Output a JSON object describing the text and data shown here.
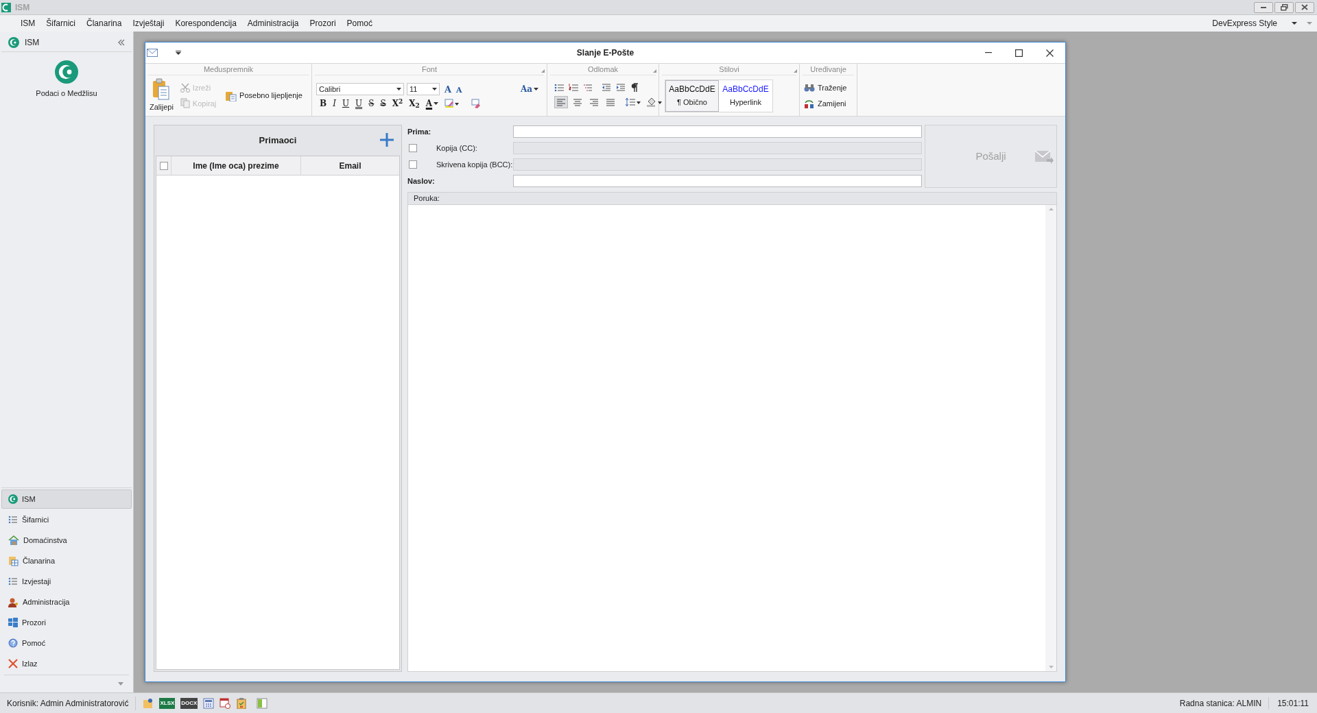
{
  "app": {
    "title": "ISM"
  },
  "menu_bar": {
    "items": [
      "ISM",
      "Šifarnici",
      "Članarina",
      "Izvještaji",
      "Korespondencija",
      "Administracija",
      "Prozori",
      "Pomoć"
    ],
    "theme": "DevExpress Style"
  },
  "sidebar": {
    "header": "ISM",
    "logo_caption": "Podaci o Medžlisu",
    "nav": [
      {
        "kind": "logo",
        "label": "ISM",
        "selected": true
      },
      {
        "kind": "list",
        "label": "Šifarnici",
        "selected": false
      },
      {
        "kind": "house",
        "label": "Domaćinstva",
        "selected": false
      },
      {
        "kind": "table",
        "label": "Članarina",
        "selected": false
      },
      {
        "kind": "list",
        "label": "Izvjestaji",
        "selected": false
      },
      {
        "kind": "user",
        "label": "Administracija",
        "selected": false
      },
      {
        "kind": "windows",
        "label": "Prozori",
        "selected": false
      },
      {
        "kind": "help",
        "label": "Pomoć",
        "selected": false
      },
      {
        "kind": "exit",
        "label": "Izlaz",
        "selected": false
      }
    ]
  },
  "dialog": {
    "title": "Slanje E-Pošte",
    "ribbon": {
      "clipboard": {
        "label": "Međuspremnik",
        "paste": "Zalijepi",
        "cut": {
          "label": "Izreži",
          "disabled": true
        },
        "copy": {
          "label": "Kopiraj",
          "disabled": true
        },
        "paste_special": "Posebno lijepljenje"
      },
      "font": {
        "label": "Font",
        "font_name": "Calibri",
        "font_size": "11",
        "case_button": "Aa",
        "size_buttons": [
          {
            "kind": "grow",
            "glyph": "A"
          },
          {
            "kind": "shrink",
            "glyph": "A"
          }
        ],
        "format_buttons": [
          {
            "kind": "bold",
            "glyph": "B"
          },
          {
            "kind": "italic",
            "glyph": "I"
          },
          {
            "kind": "underline",
            "glyph": "U"
          },
          {
            "kind": "double_underline",
            "glyph": "U"
          },
          {
            "kind": "strike",
            "glyph": "S"
          },
          {
            "kind": "double_strike",
            "glyph": "S"
          },
          {
            "kind": "superscript",
            "glyph": "X$^{2}$"
          },
          {
            "kind": "subscript",
            "glyph": "X$_{2}$"
          },
          {
            "kind": "font_color",
            "glyph": "A"
          }
        ]
      },
      "paragraph": {
        "label": "Odlomak",
        "alignments": [
          {
            "kind": "left",
            "selected": true
          },
          {
            "kind": "center",
            "selected": false
          },
          {
            "kind": "right",
            "selected": false
          },
          {
            "kind": "justify",
            "selected": false
          }
        ]
      },
      "styles": {
        "label": "Stilovi",
        "items": [
          {
            "sample": "AaBbCcDdE",
            "name": "¶ Obično",
            "kind": "normal",
            "selected": true
          },
          {
            "sample": "AaBbCcDdE",
            "name": "Hyperlink",
            "kind": "hyperlink",
            "selected": false
          }
        ]
      },
      "editing": {
        "label": "Uređivanje",
        "find": "Traženje",
        "replace": "Zamijeni"
      }
    },
    "recipients": {
      "title": "Primaoci",
      "select_all_checked": false,
      "columns": [
        "Ime (Ime oca) prezime",
        "Email"
      ]
    },
    "fields": [
      {
        "kind": "text",
        "label": "Prima:",
        "disabled": false
      },
      {
        "kind": "checkbox",
        "label": "Kopija (CC):",
        "checked": false,
        "disabled": true
      },
      {
        "kind": "checkbox",
        "label": "Skrivena kopija (BCC):",
        "checked": false,
        "disabled": true
      },
      {
        "kind": "text",
        "label": "Naslov:",
        "disabled": false
      }
    ],
    "send_button": {
      "label": "Pošalji",
      "disabled": true
    },
    "message": {
      "label": "Poruka:"
    }
  },
  "status_bar": {
    "user": "Korisnik: Admin Administratorović",
    "tools": [
      {
        "kind": "note"
      },
      {
        "kind": "file",
        "text": "XLSX",
        "color": "#1e7a45"
      },
      {
        "kind": "file",
        "text": "DOCX",
        "color": "#444444"
      },
      {
        "kind": "calculator"
      },
      {
        "kind": "calendar"
      },
      {
        "kind": "clipboard"
      },
      {
        "kind": "panel"
      }
    ],
    "workstation": "Radna stanica: ALMIN",
    "time": "15:01:11"
  }
}
